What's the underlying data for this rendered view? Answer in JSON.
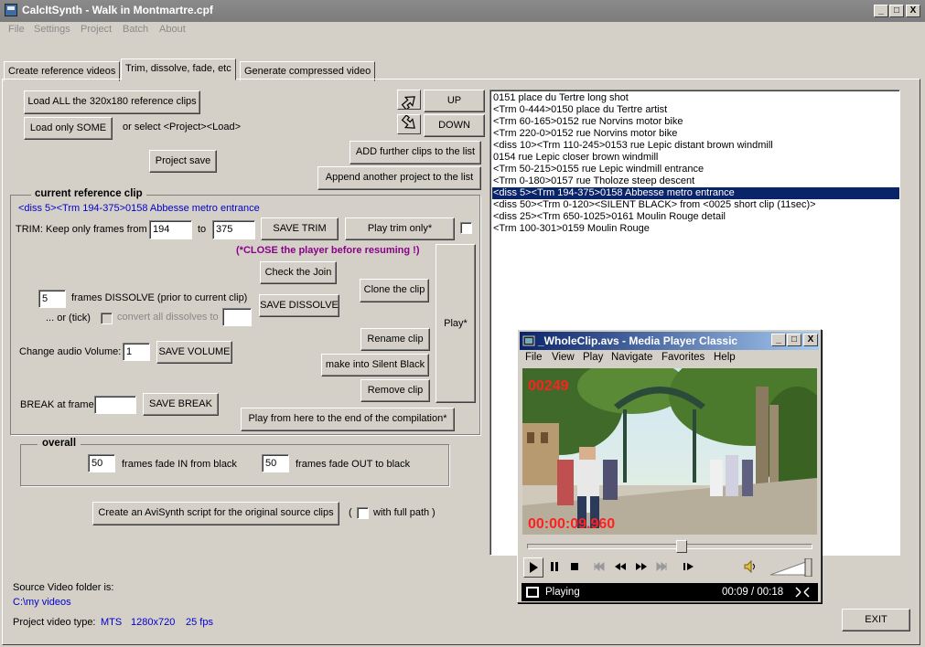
{
  "window": {
    "title": "CalcItSynth - Walk in Montmartre.cpf",
    "min_glyph": "_",
    "max_glyph": "□",
    "close_glyph": "X"
  },
  "menu": [
    "File",
    "Settings",
    "Project",
    "Batch",
    "About"
  ],
  "tabs": [
    "Create reference videos",
    "Trim, dissolve, fade, etc",
    "Generate compressed video"
  ],
  "buttons": {
    "load_all": "Load ALL the 320x180 reference clips",
    "load_some": "Load only SOME",
    "or_select": "or select <Project><Load>",
    "project_save": "Project save",
    "up": "UP",
    "down": "DOWN",
    "add_further": "ADD further clips to the list",
    "append_project": "Append another project to the list",
    "save_trim": "SAVE TRIM",
    "play_trim": "Play trim only*",
    "check_join": "Check the Join",
    "save_dissolve": "SAVE DISSOLVE",
    "clone_clip": "Clone the clip",
    "play_star": "Play*",
    "save_volume": "SAVE VOLUME",
    "rename_clip": "Rename clip",
    "silent_black": "make into Silent Black",
    "remove_clip": "Remove clip",
    "save_break": "SAVE BREAK",
    "play_from_here": "Play from here to the end of the compilation*",
    "create_avisynth": "Create an AviSynth script for the original source clips",
    "exit": "EXIT"
  },
  "current_clip": {
    "caption": "current reference clip",
    "name": "<diss 5><Trm 194-375>0158 Abbesse metro entrance",
    "trim_label": "TRIM: Keep only frames from",
    "trim_from": "194",
    "to_label": "to",
    "trim_to": "375",
    "close_warning": "(*CLOSE the player before resuming !)",
    "dissolve_value": "5",
    "dissolve_label": "frames DISSOLVE (prior to current clip)",
    "or_tick": "... or (tick)",
    "convert_all": "convert all dissolves to",
    "convert_value": "",
    "volume_label": "Change audio Volume:",
    "volume_value": "1",
    "break_label": "BREAK at frame",
    "break_value": ""
  },
  "overall": {
    "caption": "overall",
    "fade_in_value": "50",
    "fade_in_label": "frames fade IN from black",
    "fade_out_value": "50",
    "fade_out_label": "frames fade OUT to black"
  },
  "full_path": {
    "open_paren": "(",
    "label": "with full path",
    "close_paren": ")"
  },
  "clips": [
    "0151 place du Tertre long shot",
    "<Trm 0-444>0150 place du Tertre artist",
    "<Trm 60-165>0152 rue Norvins motor bike",
    "<Trm 220-0>0152 rue Norvins motor bike",
    "<diss 10><Trm 110-245>0153 rue Lepic distant brown windmill",
    "0154 rue Lepic closer brown windmill",
    "<Trm 50-215>0155 rue Lepic windmill entrance",
    "<Trm 0-180>0157 rue Tholoze steep descent",
    "<diss 5><Trm 194-375>0158 Abbesse metro entrance",
    "<diss 50><Trm 0-120><SILENT BLACK> from <0025 short clip (11sec)>",
    "<diss 25><Trm 650-1025>0161 Moulin Rouge detail",
    "<Trm 100-301>0159 Moulin Rouge"
  ],
  "selected_clip_index": 8,
  "footer": {
    "source_folder_label": "Source Video folder is:",
    "source_folder": "C:\\my videos",
    "video_type_label": "Project video type:",
    "video_type": "MTS",
    "resolution": "1280x720",
    "fps": "25 fps"
  },
  "player": {
    "title": "_WholeClip.avs - Media Player Classic",
    "menu": [
      "File",
      "View",
      "Play",
      "Navigate",
      "Favorites",
      "Help"
    ],
    "frame_counter": "00249",
    "timecode": "00:00:09.960",
    "status": "Playing",
    "time": "00:09 / 00:18",
    "seek_fraction": 0.5
  },
  "colors": {
    "selection": "#0a246a",
    "link_blue": "#0000cc",
    "warning_purple": "#8b008b",
    "overlay_red": "#ff2020"
  }
}
